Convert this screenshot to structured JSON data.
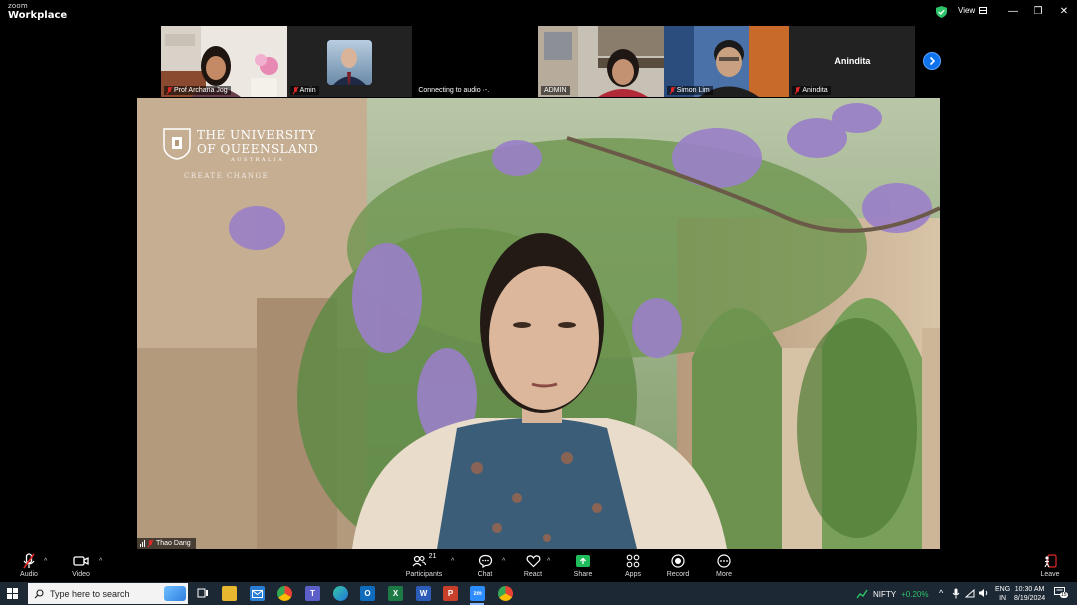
{
  "app": {
    "brand_top": "zoom",
    "brand_main": "Workplace"
  },
  "titlebar": {
    "view_label": "View",
    "minimize": "—",
    "restore": "❐",
    "close": "✕"
  },
  "gallery": {
    "tiles": [
      {
        "name": "Prof Archana Jog",
        "muted": true
      },
      {
        "name": "Amin",
        "muted": true
      },
      {
        "name": "Connecting to audio ·-.",
        "muted": false
      },
      {
        "name": "ADMIN",
        "muted": false
      },
      {
        "name": "Simon Lim",
        "muted": true
      },
      {
        "name": "Anindita",
        "muted": true,
        "display_name": "Anindita"
      }
    ]
  },
  "main": {
    "speaker_name": "Thao Dang",
    "background_logo": {
      "line1": "THE UNIVERSITY",
      "line2": "OF QUEENSLAND",
      "line3": "AUSTRALIA",
      "tagline": "CREATE CHANGE"
    }
  },
  "toolbar": {
    "audio": "Audio",
    "video": "Video",
    "participants": "Participants",
    "participants_count": "21",
    "chat": "Chat",
    "react": "React",
    "share": "Share",
    "apps": "Apps",
    "record": "Record",
    "more": "More",
    "leave": "Leave"
  },
  "taskbar": {
    "search_placeholder": "Type here to search",
    "ticker": {
      "name": "NIFTY",
      "change": "+0.20%"
    },
    "language": {
      "lang": "ENG",
      "region": "IN"
    },
    "time": "10:30 AM",
    "date": "8/19/2024",
    "notifications": "15"
  },
  "colors": {
    "accent": "#0e72ed",
    "share_green": "#1fbd5b",
    "muted_red": "#e02828"
  }
}
